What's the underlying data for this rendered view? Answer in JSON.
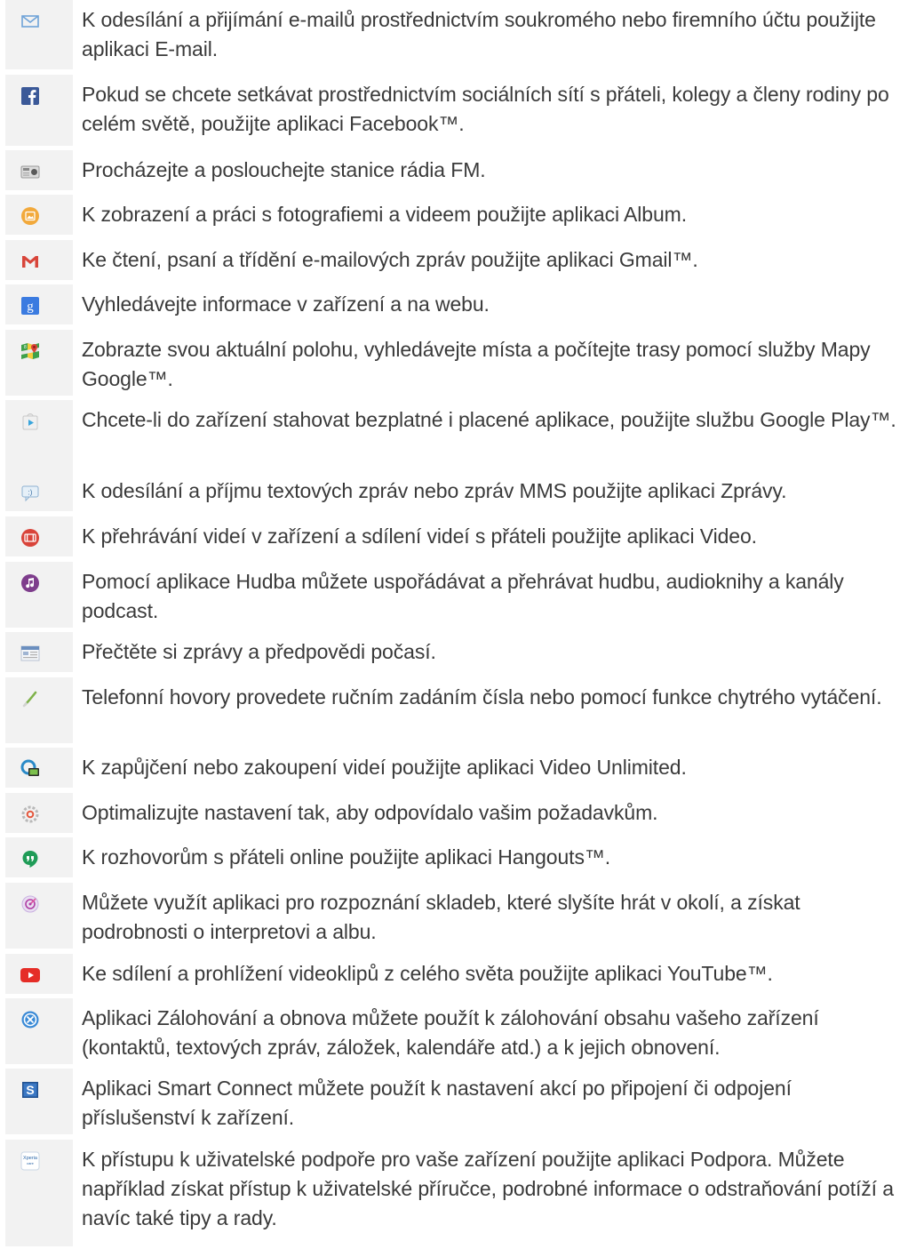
{
  "items": [
    {
      "icon": "email-icon",
      "text": "K odesílání a přijímání e-mailů prostřednictvím soukromého nebo firemního účtu použijte aplikaci E-mail."
    },
    {
      "icon": "facebook-icon",
      "text": "Pokud se chcete setkávat prostřednictvím sociálních sítí s přáteli, kolegy a členy rodiny po celém světě, použijte aplikaci Facebook™."
    },
    {
      "icon": "fm-radio-icon",
      "text": "Procházejte a poslouchejte stanice rádia FM."
    },
    {
      "icon": "album-icon",
      "text": "K zobrazení a práci s fotografiemi a videem použijte aplikaci Album."
    },
    {
      "icon": "gmail-icon",
      "text": "Ke čtení, psaní a třídění e-mailových zpráv použijte aplikaci Gmail™."
    },
    {
      "icon": "google-search-icon",
      "text": "Vyhledávejte informace v zařízení a na webu."
    },
    {
      "icon": "google-maps-icon",
      "text": "Zobrazte svou aktuální polohu, vyhledávejte místa a počítejte trasy pomocí služby Mapy Google™."
    },
    {
      "icon": "google-play-icon",
      "text": "Chcete-li do zařízení stahovat bezplatné i placené aplikace, použijte službu Google Play™."
    },
    {
      "icon": "messaging-icon",
      "text": "K odesílání a příjmu textových zpráv nebo zpráv MMS použijte aplikaci Zprávy."
    },
    {
      "icon": "video-icon",
      "text": "K přehrávání videí v zařízení a sdílení videí s přáteli použijte aplikaci Video."
    },
    {
      "icon": "music-icon",
      "text": "Pomocí aplikace Hudba můžete uspořádávat a přehrávat hudbu, audioknihy a kanály podcast."
    },
    {
      "icon": "news-weather-icon",
      "text": "Přečtěte si zprávy a předpovědi počasí."
    },
    {
      "icon": "phone-icon",
      "text": "Telefonní hovory provedete ručním zadáním čísla nebo pomocí funkce chytrého vytáčení."
    },
    {
      "icon": "video-unlimited-icon",
      "text": "K zapůjčení nebo zakoupení videí použijte aplikaci Video Unlimited."
    },
    {
      "icon": "settings-icon",
      "text": "Optimalizujte nastavení tak, aby odpovídalo vašim požadavkům."
    },
    {
      "icon": "hangouts-icon",
      "text": "K rozhovorům s přáteli online použijte aplikaci Hangouts™."
    },
    {
      "icon": "trackid-icon",
      "text": "Můžete využít aplikaci pro rozpoznání skladeb, které slyšíte hrát v okolí, a získat podrobnosti o interpretovi a albu."
    },
    {
      "icon": "youtube-icon",
      "text": "Ke sdílení a prohlížení videoklipů z celého světa použijte aplikaci YouTube™."
    },
    {
      "icon": "backup-restore-icon",
      "text": "Aplikaci Zálohování a obnova můžete použít k zálohování obsahu vašeho zařízení (kontaktů, textových zpráv, záložek, kalendáře atd.) a k jejich obnovení."
    },
    {
      "icon": "smart-connect-icon",
      "text": "Aplikaci Smart Connect můžete použít k nastavení akcí po připojení či odpojení příslušenství k zařízení."
    },
    {
      "icon": "support-icon",
      "icon_label": "Xperia care",
      "text": "K přístupu k uživatelské podpoře pro vaše zařízení použijte aplikaci Podpora. Můžete například získat přístup k uživatelské příručce, podrobné informace o odstraňování potíží a navíc také tipy a rady."
    }
  ]
}
